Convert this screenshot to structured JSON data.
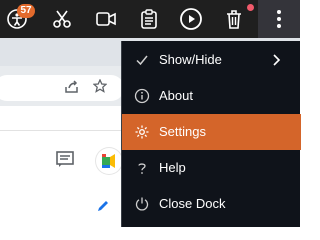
{
  "toolbar": {
    "badge_count": "57",
    "icons": [
      "accessibility-icon",
      "scissors-icon",
      "video-camera-icon",
      "clipboard-icon",
      "play-icon",
      "trash-icon",
      "more-vertical-icon"
    ],
    "accent_color": "#d4652a",
    "badge_color": "#e26a2c",
    "dot_color": "#f05a6b"
  },
  "menu": {
    "items": [
      {
        "label": "Show/Hide",
        "icon": "check-icon",
        "has_submenu": true
      },
      {
        "label": "About",
        "icon": "info-icon"
      },
      {
        "label": "Settings",
        "icon": "gear-icon",
        "active": true
      },
      {
        "label": "Help",
        "icon": "question-icon"
      },
      {
        "label": "Close Dock",
        "icon": "power-icon"
      }
    ]
  }
}
